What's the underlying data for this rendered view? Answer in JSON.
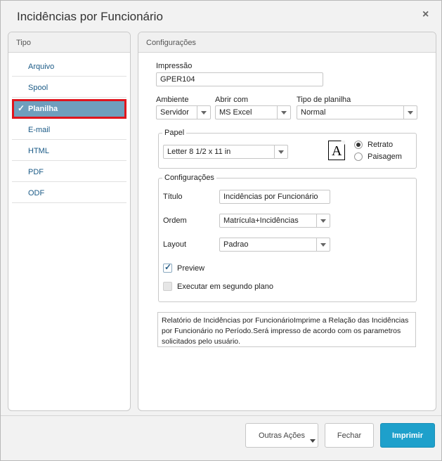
{
  "window": {
    "title": "Incidências por Funcionário",
    "close_icon": "×"
  },
  "left_panel": {
    "header": "Tipo",
    "items": [
      {
        "label": "Arquivo"
      },
      {
        "label": "Spool"
      },
      {
        "label": "Planilha",
        "selected": true
      },
      {
        "label": "E-mail"
      },
      {
        "label": "HTML"
      },
      {
        "label": "PDF"
      },
      {
        "label": "ODF"
      }
    ],
    "check_glyph": "✓"
  },
  "right_panel": {
    "header": "Configurações",
    "impressao": {
      "label": "Impressão",
      "value": "GPER104"
    },
    "ambiente": {
      "label": "Ambiente",
      "value": "Servidor"
    },
    "abrir_com": {
      "label": "Abrir com",
      "value": "MS Excel"
    },
    "tipo_planilha": {
      "label": "Tipo de planilha",
      "value": "Normal"
    },
    "papel": {
      "legend": "Papel",
      "size": "Letter 8 1/2 x 11 in",
      "icon_letter": "A",
      "orientation": {
        "retrato": "Retrato",
        "paisagem": "Paisagem",
        "selected": "Retrato"
      }
    },
    "configuracoes": {
      "legend": "Configurações",
      "titulo": {
        "label": "Título",
        "value": "Incidências por Funcionário"
      },
      "ordem": {
        "label": "Ordem",
        "value": "Matrícula+Incidências"
      },
      "layout": {
        "label": "Layout",
        "value": "Padrao"
      },
      "preview": {
        "label": "Preview",
        "checked": true
      },
      "segundo_plano": {
        "label": "Executar em segundo plano",
        "checked": false
      }
    },
    "description": "Relatório de Incidências por FuncionárioImprime a Relação das Incidências por Funcionário no Período.Será impresso de acordo com os parametros solicitados pelo usuário."
  },
  "footer": {
    "outras_acoes": "Outras Ações",
    "fechar": "Fechar",
    "imprimir": "Imprimir"
  },
  "colors": {
    "selected_item_bg": "#6f9fbd",
    "selected_highlight_border": "#e0151d",
    "primary_button": "#1ea0cb",
    "link_text": "#1a5a86"
  }
}
